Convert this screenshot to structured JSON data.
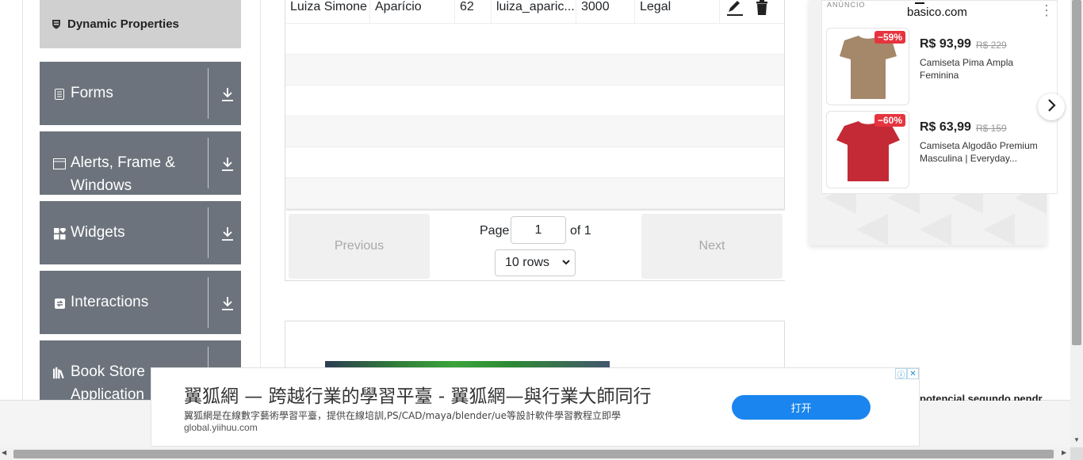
{
  "sidebar": {
    "dynamic_properties": "Dynamic Properties",
    "groups": [
      {
        "label": "Forms",
        "icon": "document-icon"
      },
      {
        "label": "Alerts, Frame & Windows",
        "icon": "window-icon"
      },
      {
        "label": "Widgets",
        "icon": "widgets-icon"
      },
      {
        "label": "Interactions",
        "icon": "interactions-icon"
      },
      {
        "label": "Book Store Application",
        "icon": "books-icon"
      }
    ]
  },
  "table": {
    "first_row": {
      "first_name": "Luiza Simone",
      "last_name": "Aparício",
      "age": "62",
      "email": "luiza_aparic...",
      "salary": "3000",
      "department": "Legal"
    }
  },
  "pagination": {
    "previous": "Previous",
    "next": "Next",
    "page_label": "Page",
    "page_value": "1",
    "of_label": "of 1",
    "rows_selected": "10 rows"
  },
  "ad_card": {
    "anuncio": "ANÚNCIO",
    "brand": "basico.com",
    "products": [
      {
        "discount": "−59%",
        "price": "R$ 93,99",
        "old_price": "R$ 229",
        "title": "Camiseta Pima Ampla Feminina",
        "color": "#a5876a"
      },
      {
        "discount": "−60%",
        "price": "R$ 63,99",
        "old_price": "R$ 159",
        "title": "Camiseta Algodão Premium Masculina | Everyday...",
        "color": "#c42a35"
      }
    ]
  },
  "banner": {
    "title": "翼狐網 — 跨越行業的學習平臺 - 翼狐網—與行業大師同行",
    "description": "翼狐網是在線數字藝術學習平臺，提供在線培訓,PS/CAD/maya/blender/ue等設計軟件學習教程立即學",
    "url": "global.yiihuu.com",
    "button": "打开"
  },
  "trailing_text": "potencial segundo pendr"
}
